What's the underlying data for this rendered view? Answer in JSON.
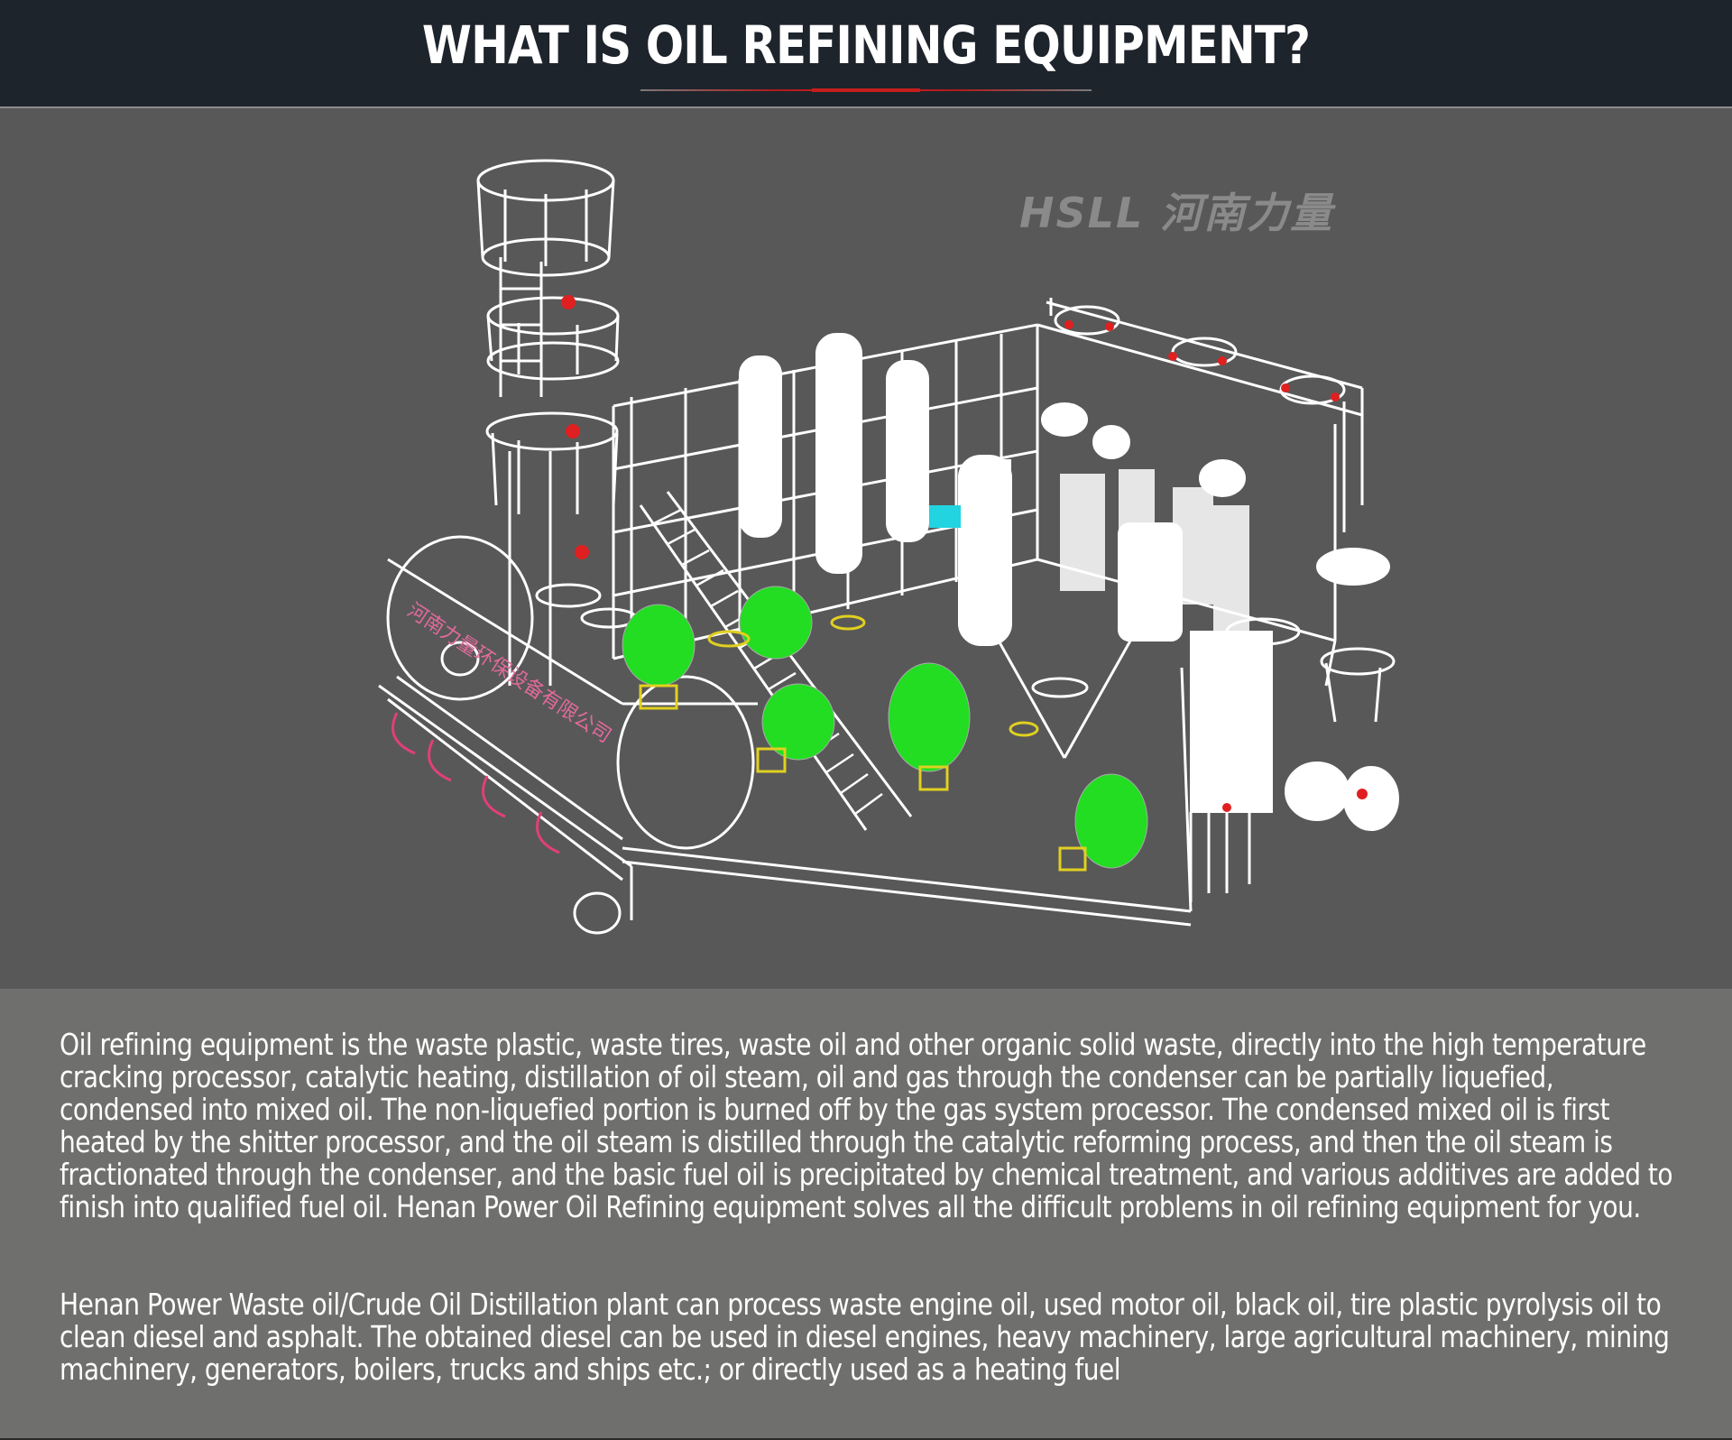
{
  "header": {
    "title": "WHAT IS OIL REFINING EQUIPMENT?"
  },
  "illustration": {
    "watermark_text": "HSLL 河南力量",
    "tank_label": "河南力量环保设备有限公司"
  },
  "body": {
    "paragraph1": "Oil refining equipment is the waste plastic, waste tires, waste oil and other organic solid waste, directly into the high temperature cracking processor, catalytic heating, distillation of oil steam, oil and gas through the condenser can be partially liquefied, condensed into mixed oil. The non-liquefied portion is burned off by the gas system processor. The condensed mixed oil is first heated by the shitter processor, and the oil steam is distilled through the catalytic reforming process, and then the oil steam is fractionated through the condenser, and the basic fuel oil is precipitated by chemical treatment, and various additives are added to finish into qualified fuel oil. Henan Power Oil Refining equipment solves all the difficult problems in oil refining equipment for you.",
    "paragraph2": "Henan Power Waste oil/Crude Oil Distillation plant can process waste engine oil, used motor oil, black oil, tire plastic pyrolysis oil to clean diesel and asphalt.  The obtained diesel can be used in diesel engines, heavy machinery, large agricultural machinery, mining machinery, generators, boilers, trucks and ships etc.;  or directly used as a heating fuel"
  },
  "colors": {
    "header_bg": "#1e242c",
    "accent_red": "#c41e1e",
    "image_bg": "#585858",
    "text_bg": "#6f706e",
    "tank_green": "#22dd22",
    "line_white": "#ffffff"
  }
}
